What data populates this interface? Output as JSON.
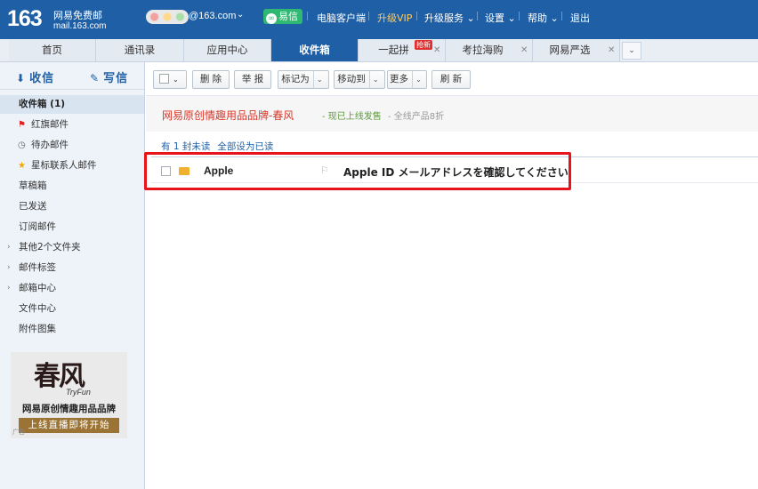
{
  "header": {
    "logo": "163",
    "logo_cn": "网易免费邮",
    "logo_url": "mail.163.com",
    "user_domain": "@163.com",
    "links": [
      "易信",
      "电脑客户端",
      "升级VIP",
      "升级服务",
      "设置",
      "帮助",
      "退出"
    ]
  },
  "tabs": [
    {
      "label": "首页"
    },
    {
      "label": "通讯录"
    },
    {
      "label": "应用中心"
    },
    {
      "label": "收件箱"
    },
    {
      "label": "一起拼",
      "badge": "抢新"
    },
    {
      "label": "考拉海购"
    },
    {
      "label": "网易严选"
    }
  ],
  "sidebar": {
    "receive_label": "收信",
    "compose_label": "写信",
    "folders": [
      {
        "label": "收件箱 (1)"
      },
      {
        "label": "红旗邮件"
      },
      {
        "label": "待办邮件"
      },
      {
        "label": "星标联系人邮件"
      },
      {
        "label": "草稿箱"
      },
      {
        "label": "已发送"
      },
      {
        "label": "订阅邮件"
      },
      {
        "label": "其他2个文件夹"
      },
      {
        "label": "邮件标签"
      },
      {
        "label": "邮箱中心"
      },
      {
        "label": "文件中心"
      },
      {
        "label": "附件图集"
      }
    ],
    "promo": {
      "logo": "春风",
      "tryfun": "TryFun",
      "brand": "网易原创情趣用品品牌",
      "cta": "上线直播即将开始",
      "ad_label": "广告"
    }
  },
  "toolbar": {
    "delete": "删 除",
    "report": "举 报",
    "mark_as": "标记为",
    "move_to": "移动到",
    "more": "更多",
    "refresh": "刷 新"
  },
  "ad": {
    "title": "网易原创情趣用品品牌-春风",
    "sub1": "- 现已上线发售",
    "sub2": "- 全线产品8折"
  },
  "mail_list": {
    "unread_text": "有 1 封未读",
    "mark_all_read": "全部设为已读",
    "rows": [
      {
        "sender": "Apple",
        "subject": "Apple ID メールアドレスを確認してください"
      }
    ]
  }
}
